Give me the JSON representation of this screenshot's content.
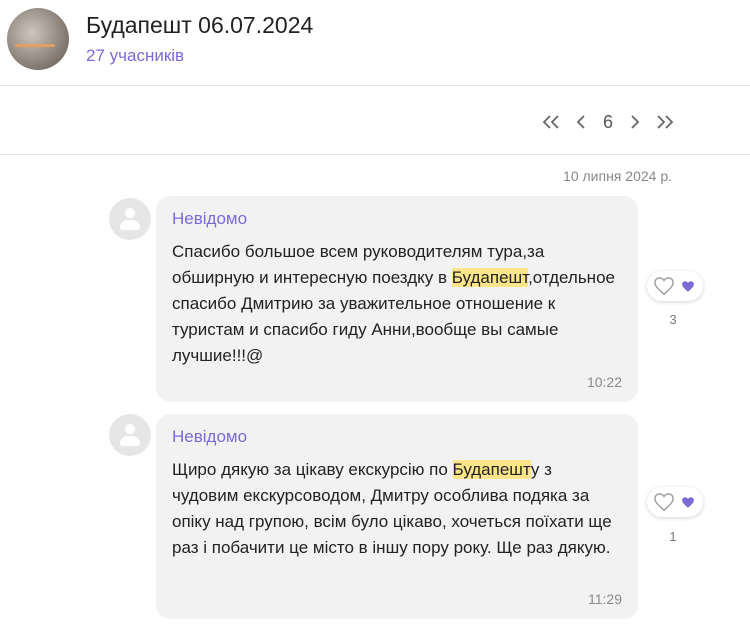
{
  "header": {
    "title": "Будапешт 06.07.2024",
    "members": "27 учасників"
  },
  "pager": {
    "current_page": "6"
  },
  "date_label": "10 липня 2024 р.",
  "messages": [
    {
      "author": "Невідомо",
      "text_parts": [
        "Спасибо большое всем руководителям тура,за обширную и интересную поездку в ",
        "Будапешт",
        ",отдельное спасибо Дмитрию за уважительное отношение к туристам и спасибо гиду Анни,вообще вы  самые лучшие!!!@"
      ],
      "time": "10:22",
      "reactions": "3"
    },
    {
      "author": "Невідомо",
      "text_parts": [
        "Щиро дякую за цікаву екскурсію по ",
        "Будапешт",
        "у з чудовим екскурсоводом, Дмитру особлива подяка за опіку над групою, всім було цікаво, хочеться поїхати ще раз і побачити це місто в іншу пору року. Ще раз дякую."
      ],
      "time": "11:29",
      "reactions": "1"
    }
  ],
  "colors": {
    "accent": "#7b6bd6",
    "highlight": "#fde68a",
    "bubble": "#f2f2f2"
  }
}
